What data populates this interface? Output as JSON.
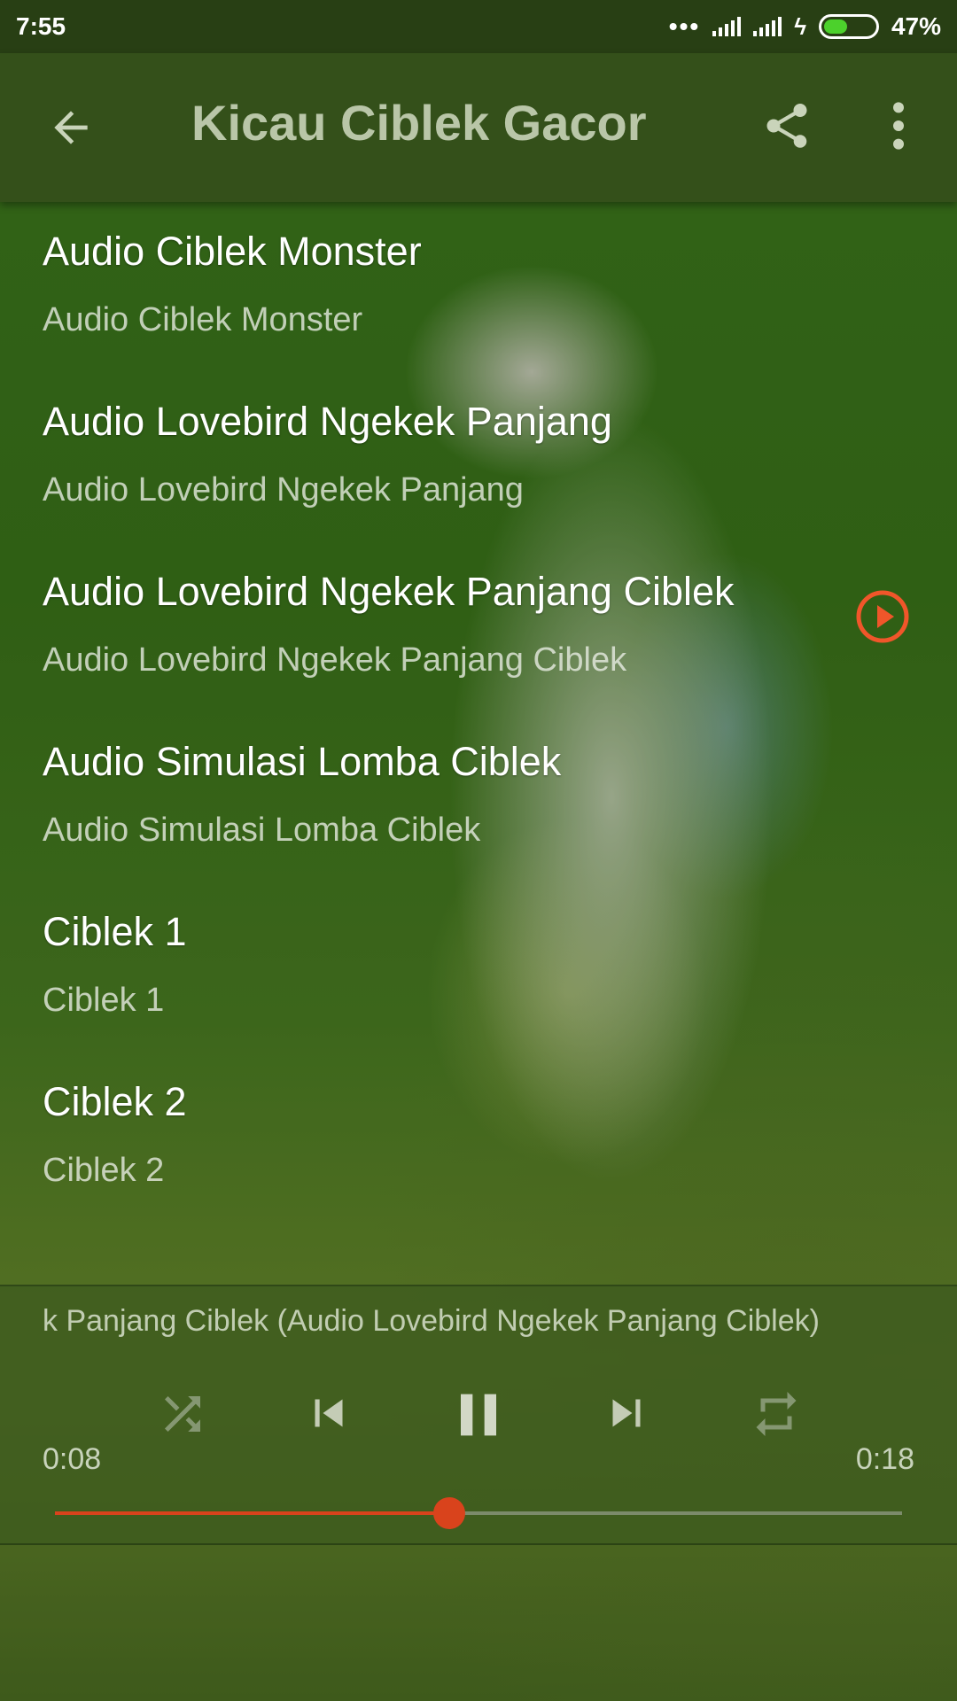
{
  "status_bar": {
    "time": "7:55",
    "battery_percent": "47%",
    "battery_level": 0.47,
    "icons": [
      "more-dots-icon",
      "signal-icon",
      "signal-icon",
      "charging-icon",
      "battery-icon"
    ]
  },
  "app_bar": {
    "title": "Kicau Ciblek Gacor",
    "back_icon": "arrow-back-icon",
    "share_icon": "share-icon",
    "menu_icon": "more-vert-icon"
  },
  "tracks": [
    {
      "title": "Audio Ciblek Monster",
      "subtitle": "Audio Ciblek Monster"
    },
    {
      "title": "Audio Lovebird Ngekek Panjang",
      "subtitle": "Audio Lovebird Ngekek Panjang"
    },
    {
      "title": "Audio Lovebird Ngekek Panjang Ciblek",
      "subtitle": "Audio Lovebird Ngekek Panjang Ciblek"
    },
    {
      "title": "Audio Simulasi Lomba Ciblek",
      "subtitle": "Audio Simulasi Lomba Ciblek"
    },
    {
      "title": "Ciblek 1",
      "subtitle": "Ciblek 1"
    },
    {
      "title": "Ciblek 2",
      "subtitle": "Ciblek 2"
    }
  ],
  "player": {
    "now_playing": "k Panjang Ciblek (Audio Lovebird Ngekek Panjang Ciblek)",
    "elapsed": "0:08",
    "total": "0:18",
    "progress": 0.466,
    "controls": [
      "shuffle-icon",
      "skip-previous-icon",
      "pause-icon",
      "skip-next-icon",
      "repeat-icon"
    ]
  },
  "colors": {
    "accent": "#d9431c",
    "app_bar": "#34501a",
    "status_bar": "#283f14",
    "title_text": "#b9c6a8",
    "battery_fill": "#4cd12c"
  }
}
